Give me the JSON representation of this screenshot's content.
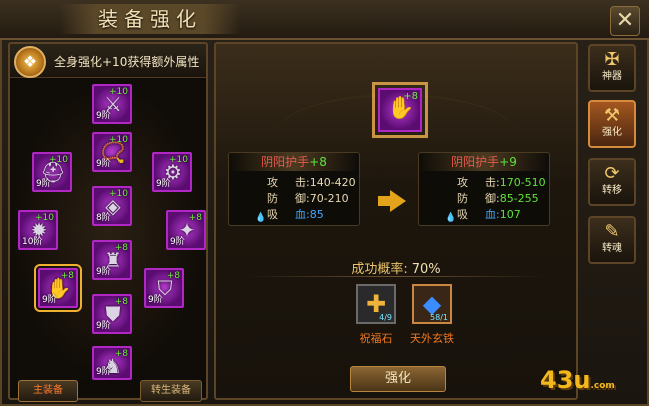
{
  "window": {
    "title": "装备强化",
    "close": "✕"
  },
  "left": {
    "header": "全身强化+10获得额外属性",
    "slots": [
      {
        "tier": "9阶",
        "plus": "+10",
        "glyph": "⚔"
      },
      {
        "tier": "9阶",
        "plus": "+10",
        "glyph": "📿"
      },
      {
        "tier": "9阶",
        "plus": "+10",
        "glyph": "⛑"
      },
      {
        "tier": "9阶",
        "plus": "+10",
        "glyph": "⚙"
      },
      {
        "tier": "8阶",
        "plus": "+10",
        "glyph": "◈"
      },
      {
        "tier": "10阶",
        "plus": "+10",
        "glyph": "✹"
      },
      {
        "tier": "9阶",
        "plus": "+8",
        "glyph": "✦"
      },
      {
        "tier": "9阶",
        "plus": "+8",
        "glyph": "♜"
      },
      {
        "tier": "9阶",
        "plus": "+8",
        "glyph": "✋"
      },
      {
        "tier": "9阶",
        "plus": "+8",
        "glyph": "⛉"
      },
      {
        "tier": "9阶",
        "plus": "+8",
        "glyph": "⛊"
      },
      {
        "tier": "9阶",
        "plus": "+8",
        "glyph": "♞"
      }
    ],
    "tabs": [
      "主装备",
      "转生装备"
    ]
  },
  "center": {
    "item_plus": "+8",
    "current": {
      "name": "阴阳护手",
      "plus": "+8",
      "atk_k": "攻",
      "atk_label": "击:",
      "atk_v": "140-420",
      "def_k": "防",
      "def_label": "御:",
      "def_v": "70-210",
      "hp_k": "吸",
      "hp_label": "血:",
      "hp_v": "85"
    },
    "next": {
      "name": "阴阳护手",
      "plus": "+9",
      "atk_k": "攻",
      "atk_label": "击:",
      "atk_v": "170-510",
      "def_k": "防",
      "def_label": "御:",
      "def_v": "85-255",
      "hp_k": "吸",
      "hp_label": "血:",
      "hp_v": "107"
    },
    "success_label": "成功概率:",
    "success_value": "70%",
    "materials": [
      {
        "name": "祝福石",
        "count": "4/9",
        "glyph": "✚"
      },
      {
        "name": "天外玄铁",
        "count": "58/1",
        "glyph": "◆"
      }
    ],
    "button": "强化"
  },
  "right_tabs": [
    {
      "label": "神器",
      "icon": "✠"
    },
    {
      "label": "强化",
      "icon": "⚒"
    },
    {
      "label": "转移",
      "icon": "⟳"
    },
    {
      "label": "转魂",
      "icon": "✎"
    }
  ],
  "logo": {
    "main": "43u",
    "suffix": ".com"
  }
}
